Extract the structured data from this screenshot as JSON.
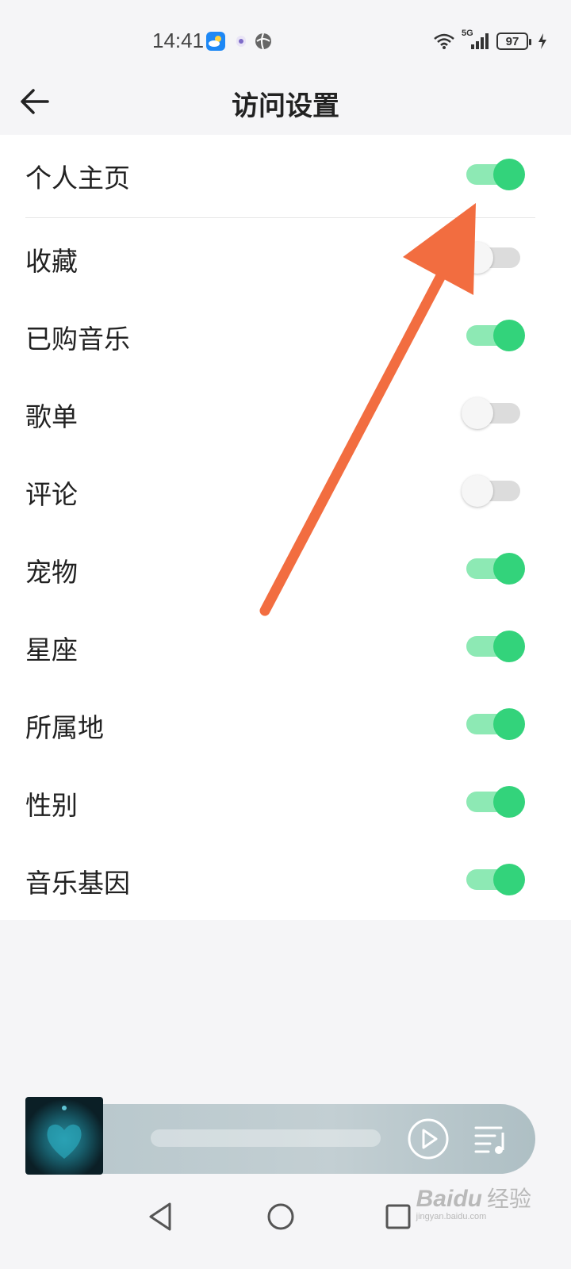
{
  "status_bar": {
    "time": "14:41",
    "network": "5G",
    "battery": "97",
    "icons": [
      "weather-app-icon",
      "security-app-icon",
      "browser-app-icon",
      "wifi-icon",
      "signal-icon",
      "battery-icon",
      "charging-icon"
    ]
  },
  "header": {
    "back_icon": "back-arrow-icon",
    "title": "访问设置"
  },
  "settings": [
    {
      "label": "个人主页",
      "enabled": true
    },
    {
      "label": "收藏",
      "enabled": false
    },
    {
      "label": "已购音乐",
      "enabled": true
    },
    {
      "label": "歌单",
      "enabled": false
    },
    {
      "label": "评论",
      "enabled": false
    },
    {
      "label": "宠物",
      "enabled": true
    },
    {
      "label": "星座",
      "enabled": true
    },
    {
      "label": "所属地",
      "enabled": true
    },
    {
      "label": "性别",
      "enabled": true
    },
    {
      "label": "音乐基因",
      "enabled": true
    }
  ],
  "player": {
    "cover_icon": "album-cover",
    "play_icon": "play-icon",
    "playlist_icon": "playlist-icon"
  },
  "navigation": {
    "icons": [
      "nav-back-icon",
      "nav-home-icon",
      "nav-recents-icon"
    ]
  },
  "watermark": {
    "brand": "Baidu",
    "sub": "经验",
    "url": "jingyan.baidu.com"
  },
  "colors": {
    "toggle_on_knob": "#33d37b",
    "toggle_on_track": "#8de9b4",
    "toggle_off_track": "#dcdcdc",
    "annotation_arrow": "#f26d40"
  }
}
